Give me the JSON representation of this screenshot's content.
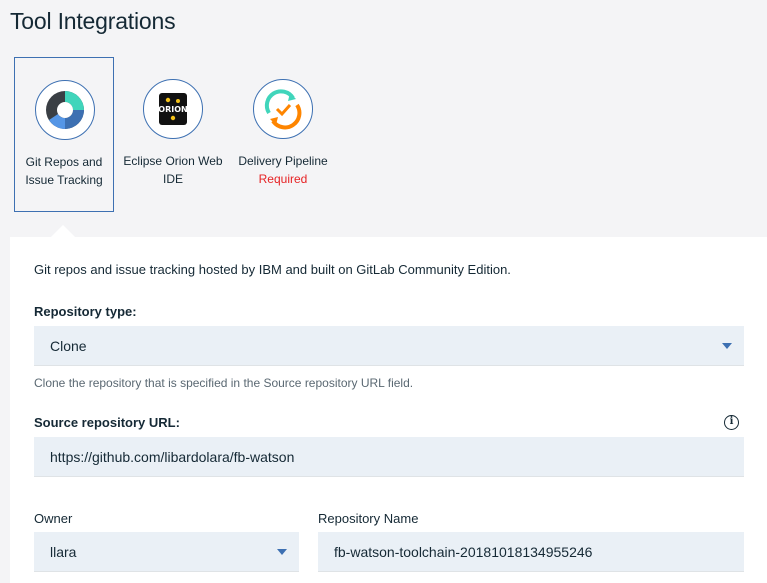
{
  "page": {
    "title": "Tool Integrations"
  },
  "tiles": [
    {
      "label_line1": "Git Repos and",
      "label_line2": "Issue Tracking",
      "icon": "git-repos-icon",
      "selected": true
    },
    {
      "label_line1": "Eclipse Orion Web",
      "label_line2": "IDE",
      "icon": "orion-icon",
      "icon_text": "ORION"
    },
    {
      "label_line1": "Delivery Pipeline",
      "status": "Required",
      "icon": "delivery-pipeline-icon"
    }
  ],
  "panel": {
    "description": "Git repos and issue tracking hosted by IBM and built on GitLab Community Edition.",
    "repository_type": {
      "label": "Repository type:",
      "value": "Clone",
      "helper": "Clone the repository that is specified in the Source repository URL field."
    },
    "source_url": {
      "label": "Source repository URL:",
      "value": "https://github.com/libardolara/fb-watson"
    },
    "owner": {
      "label": "Owner",
      "value": "llara"
    },
    "repository_name": {
      "label": "Repository Name",
      "value": "fb-watson-toolchain-20181018134955246"
    }
  },
  "colors": {
    "accent": "#3d70b2",
    "required": "#e62325",
    "field_bg": "#eaf0f6"
  }
}
